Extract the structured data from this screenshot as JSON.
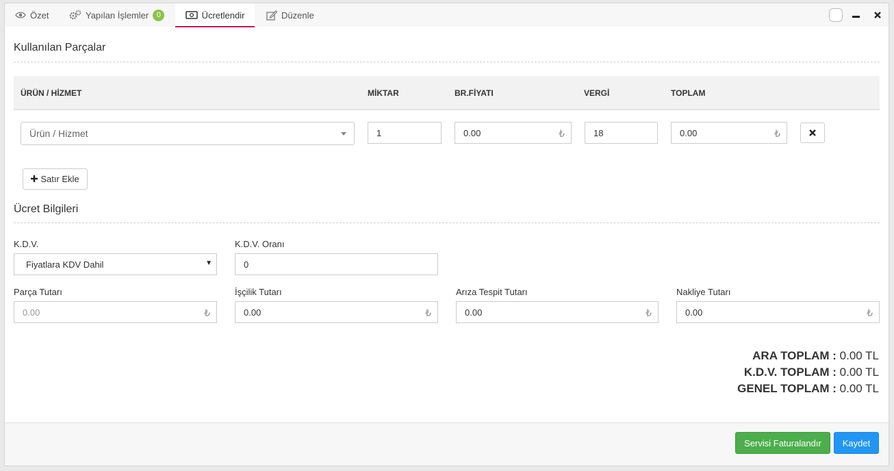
{
  "tabs": [
    {
      "label": "Özet",
      "icon": "eye-icon"
    },
    {
      "label": "Yapılan İşlemler",
      "icon": "gears-icon",
      "badge": "0"
    },
    {
      "label": "Ücretlendir",
      "icon": "money-icon",
      "active": true
    },
    {
      "label": "Düzenle",
      "icon": "edit-icon"
    }
  ],
  "parts": {
    "title": "Kullanılan Parçalar",
    "columns": {
      "product": "ÜRÜN / HİZMET",
      "quantity": "MİKTAR",
      "unit_price": "BR.FİYATI",
      "tax": "VERGİ",
      "total": "TOPLAM"
    },
    "row": {
      "product_placeholder": "Ürün / Hizmet",
      "quantity": "1",
      "unit_price": "0.00",
      "tax": "18",
      "total": "0.00"
    },
    "currency_symbol": "₺",
    "add_row_label": "Satır Ekle"
  },
  "fee": {
    "title": "Ücret Bilgileri",
    "kdv_label": "K.D.V.",
    "kdv_value": "Fiyatlara KDV Dahil",
    "kdv_rate_label": "K.D.V. Oranı",
    "kdv_rate_value": "0",
    "parts_amount_label": "Parça Tutarı",
    "parts_amount_value": "0.00",
    "labor_label": "İşçilik Tutarı",
    "labor_value": "0.00",
    "diagnosis_label": "Arıza Tespit Tutarı",
    "diagnosis_value": "0.00",
    "shipping_label": "Nakliye Tutarı",
    "shipping_value": "0.00"
  },
  "totals": {
    "subtotal_label": "ARA TOPLAM :",
    "subtotal_value": "0.00 TL",
    "kdv_total_label": "K.D.V. TOPLAM :",
    "kdv_total_value": "0.00 TL",
    "grand_total_label": "GENEL TOPLAM :",
    "grand_total_value": "0.00 TL"
  },
  "footer": {
    "invoice_label": "Servisi Faturalandır",
    "save_label": "Kaydet"
  },
  "colors": {
    "active_tab_underline": "#c2185b",
    "badge": "#8bc34a",
    "invoice_button": "#4cae4c",
    "save_button": "#2196f3"
  }
}
